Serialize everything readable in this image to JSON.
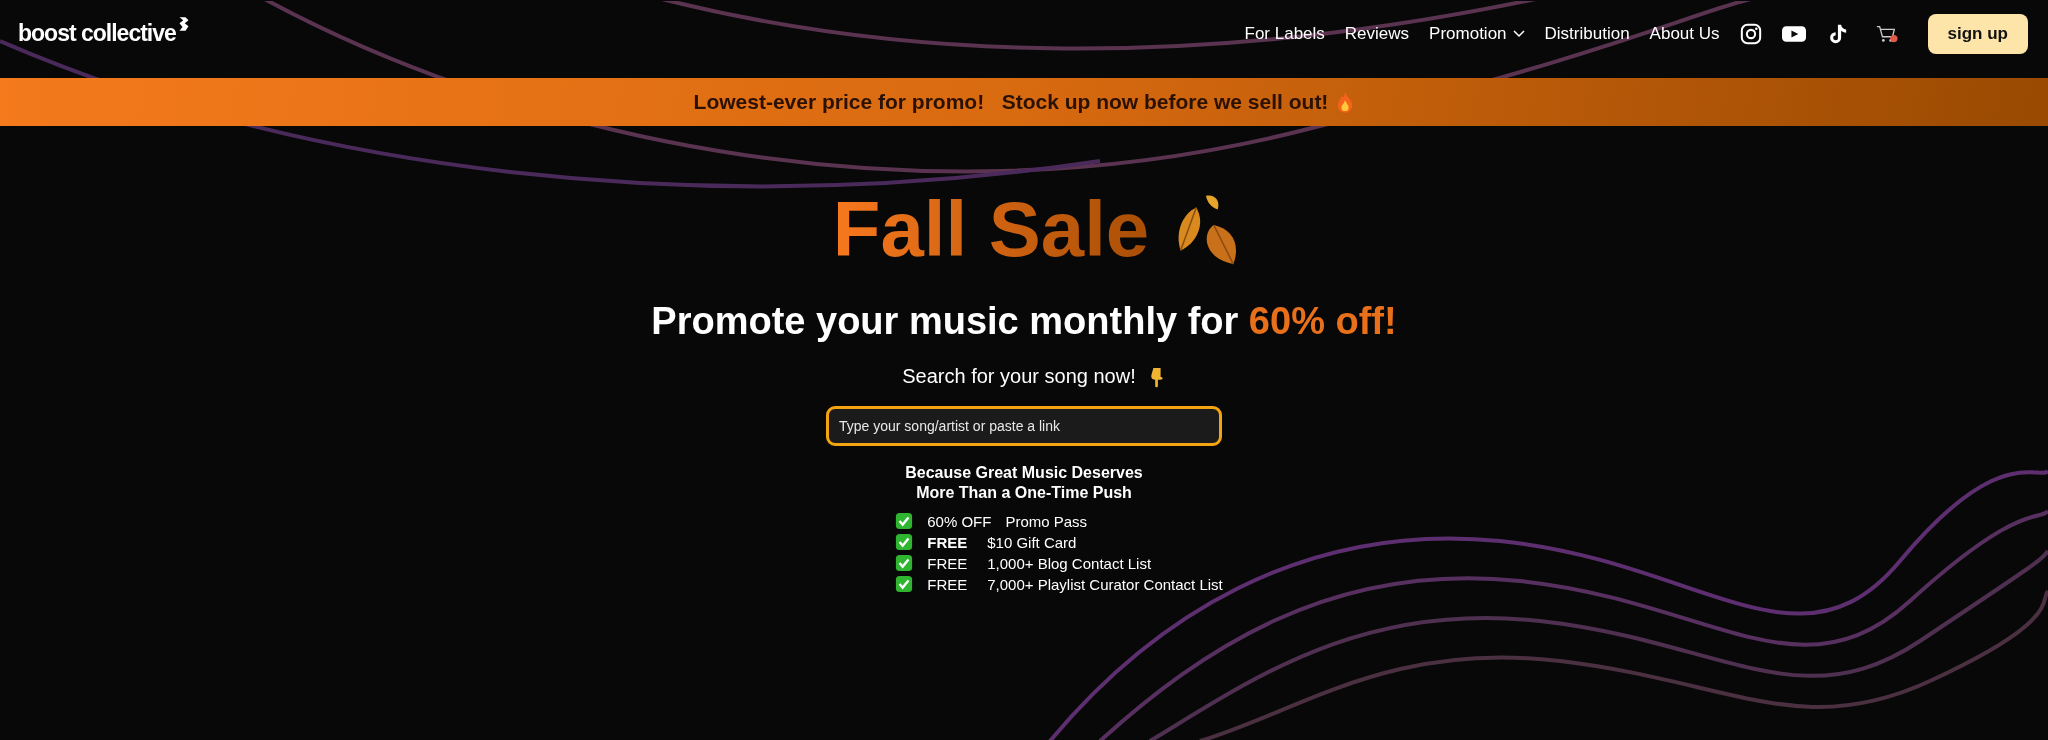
{
  "header": {
    "logo": "boost collective",
    "nav": [
      {
        "label": "For Labels",
        "has_menu": false
      },
      {
        "label": "Reviews",
        "has_menu": false
      },
      {
        "label": "Promotion",
        "has_menu": true
      },
      {
        "label": "Distribution",
        "has_menu": false
      },
      {
        "label": "About Us",
        "has_menu": false
      }
    ],
    "signup": "sign up"
  },
  "banner": {
    "text": "Lowest-ever price for promo!   Stock up now before we sell out!"
  },
  "hero": {
    "title": "Fall Sale",
    "subtitle": "Promote your music monthly for **60% off!**",
    "prompt": "Search for your song now!",
    "search": {
      "placeholder": "Type your song/artist or paste a link"
    },
    "tagline": [
      "Because Great Music Deserves",
      "More Than a One-Time Push"
    ],
    "perks": [
      {
        "tag": "60% OFF",
        "text": "Promo Pass",
        "bold": false
      },
      {
        "tag": "FREE",
        "text": "$10 Gift Card",
        "bold": true
      },
      {
        "tag": "FREE",
        "text": "1,000+ Blog Contact List",
        "bold": false
      },
      {
        "tag": "FREE",
        "text": "7,000+ Playlist Curator Contact List",
        "bold": false
      }
    ]
  }
}
